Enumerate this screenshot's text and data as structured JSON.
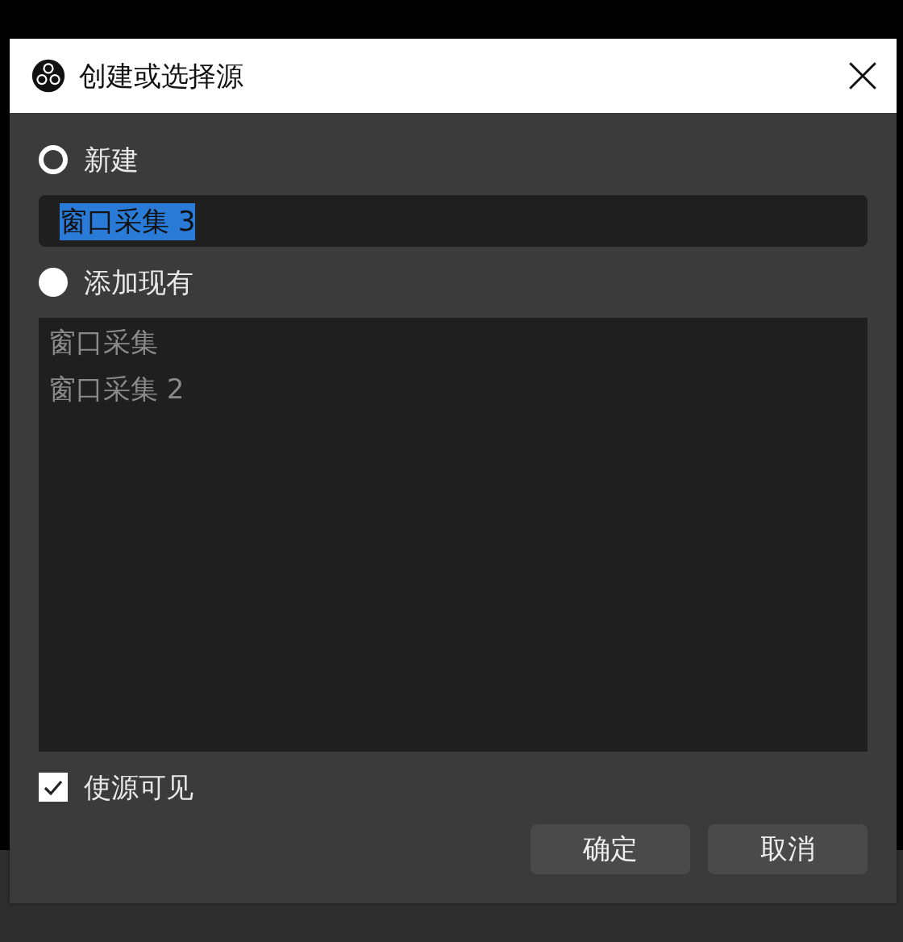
{
  "window": {
    "title": "创建或选择源"
  },
  "options": [
    {
      "label": "新建",
      "selected": true
    },
    {
      "label": "添加现有",
      "selected": false
    }
  ],
  "name_field": {
    "value": "窗口采集 3",
    "text_selected": true
  },
  "existing_list": {
    "disabled": true,
    "items": [
      "窗口采集",
      "窗口采集 2"
    ]
  },
  "visible_checkbox": {
    "label": "使源可见",
    "checked": true
  },
  "buttons": [
    "确定",
    "取消"
  ]
}
